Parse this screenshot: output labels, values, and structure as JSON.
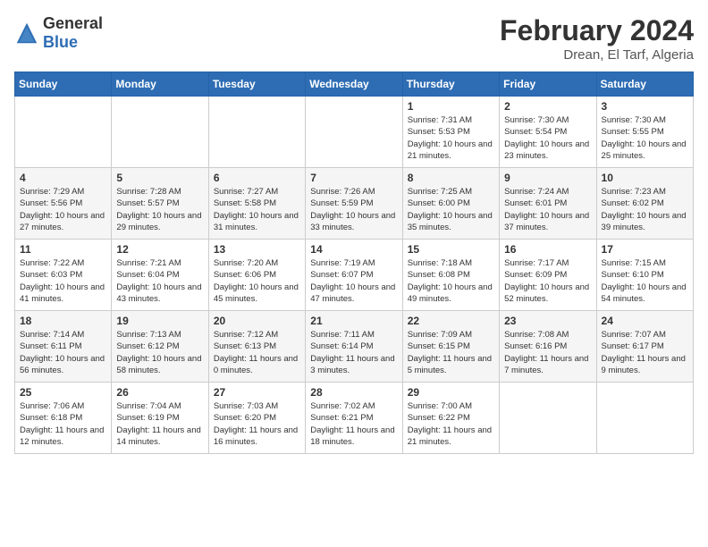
{
  "header": {
    "logo": {
      "general": "General",
      "blue": "Blue"
    },
    "title": "February 2024",
    "location": "Drean, El Tarf, Algeria"
  },
  "weekdays": [
    "Sunday",
    "Monday",
    "Tuesday",
    "Wednesday",
    "Thursday",
    "Friday",
    "Saturday"
  ],
  "weeks": [
    [
      {
        "day": "",
        "info": ""
      },
      {
        "day": "",
        "info": ""
      },
      {
        "day": "",
        "info": ""
      },
      {
        "day": "",
        "info": ""
      },
      {
        "day": "1",
        "info": "Sunrise: 7:31 AM\nSunset: 5:53 PM\nDaylight: 10 hours\nand 21 minutes."
      },
      {
        "day": "2",
        "info": "Sunrise: 7:30 AM\nSunset: 5:54 PM\nDaylight: 10 hours\nand 23 minutes."
      },
      {
        "day": "3",
        "info": "Sunrise: 7:30 AM\nSunset: 5:55 PM\nDaylight: 10 hours\nand 25 minutes."
      }
    ],
    [
      {
        "day": "4",
        "info": "Sunrise: 7:29 AM\nSunset: 5:56 PM\nDaylight: 10 hours\nand 27 minutes."
      },
      {
        "day": "5",
        "info": "Sunrise: 7:28 AM\nSunset: 5:57 PM\nDaylight: 10 hours\nand 29 minutes."
      },
      {
        "day": "6",
        "info": "Sunrise: 7:27 AM\nSunset: 5:58 PM\nDaylight: 10 hours\nand 31 minutes."
      },
      {
        "day": "7",
        "info": "Sunrise: 7:26 AM\nSunset: 5:59 PM\nDaylight: 10 hours\nand 33 minutes."
      },
      {
        "day": "8",
        "info": "Sunrise: 7:25 AM\nSunset: 6:00 PM\nDaylight: 10 hours\nand 35 minutes."
      },
      {
        "day": "9",
        "info": "Sunrise: 7:24 AM\nSunset: 6:01 PM\nDaylight: 10 hours\nand 37 minutes."
      },
      {
        "day": "10",
        "info": "Sunrise: 7:23 AM\nSunset: 6:02 PM\nDaylight: 10 hours\nand 39 minutes."
      }
    ],
    [
      {
        "day": "11",
        "info": "Sunrise: 7:22 AM\nSunset: 6:03 PM\nDaylight: 10 hours\nand 41 minutes."
      },
      {
        "day": "12",
        "info": "Sunrise: 7:21 AM\nSunset: 6:04 PM\nDaylight: 10 hours\nand 43 minutes."
      },
      {
        "day": "13",
        "info": "Sunrise: 7:20 AM\nSunset: 6:06 PM\nDaylight: 10 hours\nand 45 minutes."
      },
      {
        "day": "14",
        "info": "Sunrise: 7:19 AM\nSunset: 6:07 PM\nDaylight: 10 hours\nand 47 minutes."
      },
      {
        "day": "15",
        "info": "Sunrise: 7:18 AM\nSunset: 6:08 PM\nDaylight: 10 hours\nand 49 minutes."
      },
      {
        "day": "16",
        "info": "Sunrise: 7:17 AM\nSunset: 6:09 PM\nDaylight: 10 hours\nand 52 minutes."
      },
      {
        "day": "17",
        "info": "Sunrise: 7:15 AM\nSunset: 6:10 PM\nDaylight: 10 hours\nand 54 minutes."
      }
    ],
    [
      {
        "day": "18",
        "info": "Sunrise: 7:14 AM\nSunset: 6:11 PM\nDaylight: 10 hours\nand 56 minutes."
      },
      {
        "day": "19",
        "info": "Sunrise: 7:13 AM\nSunset: 6:12 PM\nDaylight: 10 hours\nand 58 minutes."
      },
      {
        "day": "20",
        "info": "Sunrise: 7:12 AM\nSunset: 6:13 PM\nDaylight: 11 hours\nand 0 minutes."
      },
      {
        "day": "21",
        "info": "Sunrise: 7:11 AM\nSunset: 6:14 PM\nDaylight: 11 hours\nand 3 minutes."
      },
      {
        "day": "22",
        "info": "Sunrise: 7:09 AM\nSunset: 6:15 PM\nDaylight: 11 hours\nand 5 minutes."
      },
      {
        "day": "23",
        "info": "Sunrise: 7:08 AM\nSunset: 6:16 PM\nDaylight: 11 hours\nand 7 minutes."
      },
      {
        "day": "24",
        "info": "Sunrise: 7:07 AM\nSunset: 6:17 PM\nDaylight: 11 hours\nand 9 minutes."
      }
    ],
    [
      {
        "day": "25",
        "info": "Sunrise: 7:06 AM\nSunset: 6:18 PM\nDaylight: 11 hours\nand 12 minutes."
      },
      {
        "day": "26",
        "info": "Sunrise: 7:04 AM\nSunset: 6:19 PM\nDaylight: 11 hours\nand 14 minutes."
      },
      {
        "day": "27",
        "info": "Sunrise: 7:03 AM\nSunset: 6:20 PM\nDaylight: 11 hours\nand 16 minutes."
      },
      {
        "day": "28",
        "info": "Sunrise: 7:02 AM\nSunset: 6:21 PM\nDaylight: 11 hours\nand 18 minutes."
      },
      {
        "day": "29",
        "info": "Sunrise: 7:00 AM\nSunset: 6:22 PM\nDaylight: 11 hours\nand 21 minutes."
      },
      {
        "day": "",
        "info": ""
      },
      {
        "day": "",
        "info": ""
      }
    ]
  ]
}
